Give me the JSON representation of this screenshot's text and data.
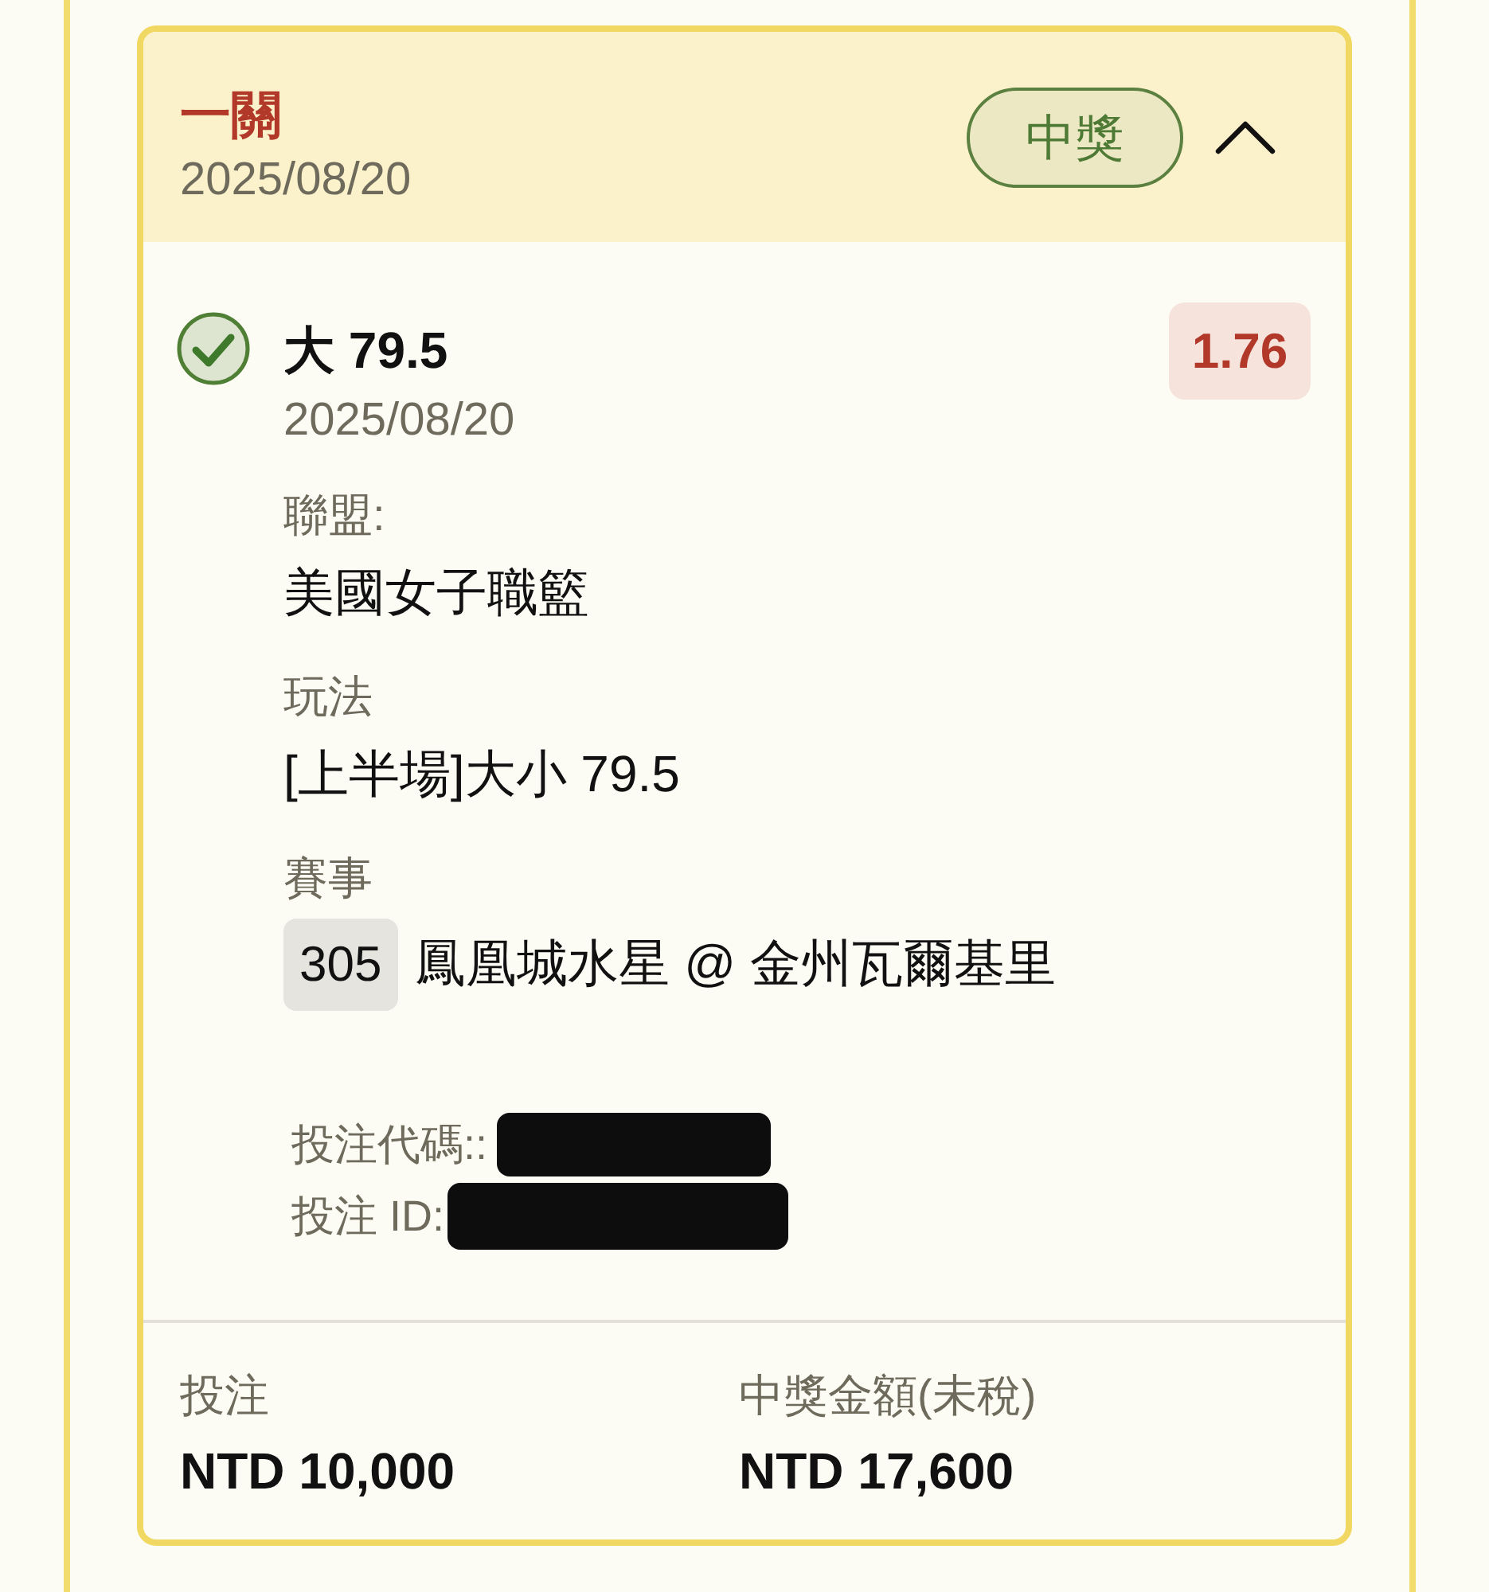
{
  "bet_card": {
    "title": "一關",
    "date": "2025/08/20",
    "status": {
      "label": "中獎",
      "won": true
    },
    "expanded": true,
    "selections": [
      {
        "won": true,
        "pick": "大 79.5",
        "date": "2025/08/20",
        "odds": "1.76",
        "fields": [
          {
            "kind": "text",
            "label": "聯盟:",
            "value": "美國女子職籃"
          },
          {
            "kind": "text",
            "label": "玩法",
            "value": "[上半場]大小 79.5"
          },
          {
            "kind": "match",
            "label": "賽事",
            "number": "305",
            "value": "鳳凰城水星 @ 金州瓦爾基里"
          }
        ],
        "codes": [
          {
            "label": "投注代碼::",
            "redacted": true
          },
          {
            "label": "投注 ID:",
            "redacted": true
          }
        ]
      }
    ],
    "summary": [
      {
        "label": "投注",
        "value": "NTD 10,000"
      },
      {
        "label": "中獎金額(未稅)",
        "value": "NTD 17,600"
      }
    ]
  }
}
